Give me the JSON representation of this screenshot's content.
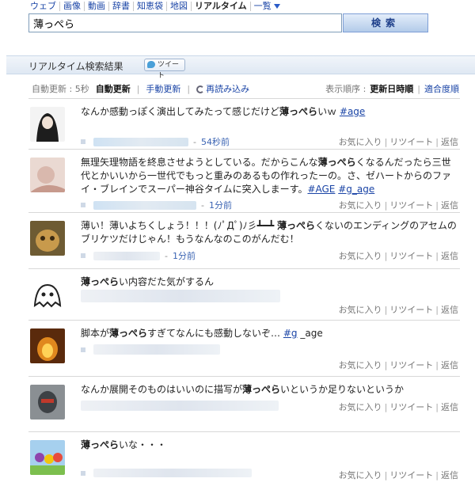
{
  "nav": {
    "tabs": [
      "ウェブ",
      "画像",
      "動画",
      "辞書",
      "知恵袋",
      "地図",
      "リアルタイム",
      "一覧"
    ]
  },
  "search": {
    "value": "薄っぺら",
    "button": "検索"
  },
  "results": {
    "title": "リアルタイム検索結果",
    "tweet_button": "ツイート"
  },
  "toolbar": {
    "auto_update": "自動更新 : 5秒",
    "auto": "自動更新",
    "manual": "手動更新",
    "reload": "再読み込み",
    "order_label": "表示順序 :",
    "order_time": "更新日時順",
    "order_relevance": "適合度順"
  },
  "actions": {
    "favorite": "お気に入り",
    "retweet": "リツイート",
    "reply": "返信"
  },
  "tweets": [
    {
      "parts": [
        {
          "t": "なんか感動っぽく演出してみたって感じだけど"
        },
        {
          "t": "薄っぺら",
          "k": 1
        },
        {
          "t": "いｗ "
        },
        {
          "t": "#age",
          "h": 1
        }
      ],
      "time": "54秒前"
    },
    {
      "parts": [
        {
          "t": "無理矢理物語を終息させようとしている。だからこんな"
        },
        {
          "t": "薄っぺら",
          "k": 1
        },
        {
          "t": "くなるんだったら三世代とかいいから一世代でもっと重みのあるもの作れったーの。さ、ゼハートからのファイ・ブレインでスーパー神谷タイムに突入しまーす。"
        },
        {
          "t": "#AGE",
          "h": 1
        },
        {
          "t": " "
        },
        {
          "t": "#g_age",
          "h": 1
        }
      ],
      "time": "1分前"
    },
    {
      "parts": [
        {
          "t": "薄い！薄いよちくしょう！！！(ﾉﾟДﾟ)ﾉ彡┻━┻ "
        },
        {
          "t": "薄っぺら",
          "k": 1
        },
        {
          "t": "くないのエンディングのアセムのブリケツだけじゃん！もうなんなのこのがんだむ！"
        }
      ],
      "time": "1分前"
    },
    {
      "parts": [
        {
          "t": "薄っぺら",
          "k": 1
        },
        {
          "t": "い内容だた気がするん"
        }
      ],
      "time": ""
    },
    {
      "parts": [
        {
          "t": "脚本が"
        },
        {
          "t": "薄っぺら",
          "k": 1
        },
        {
          "t": "すぎてなんにも感動しないぞ… "
        },
        {
          "t": "#g",
          "h": 1
        },
        {
          "t": " _age"
        }
      ],
      "time": ""
    },
    {
      "parts": [
        {
          "t": "なんか展開そのものはいいのに描写が"
        },
        {
          "t": "薄っぺら",
          "k": 1
        },
        {
          "t": "いというか足りないというか"
        }
      ],
      "time": ""
    },
    {
      "parts": [
        {
          "t": "薄っぺら",
          "k": 1
        },
        {
          "t": "いな・・・"
        }
      ],
      "time": ""
    }
  ]
}
